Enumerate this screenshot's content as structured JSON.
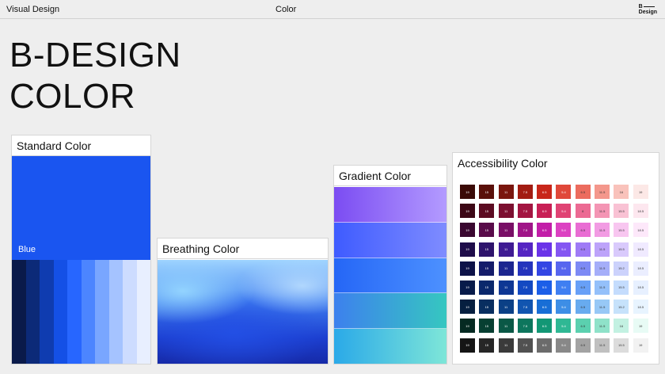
{
  "topbar": {
    "left": "Visual Design",
    "center": "Color",
    "logo_top": "B",
    "logo_bottom": "Design"
  },
  "hero": {
    "line1": "B-DESIGN",
    "line2": "COLOR"
  },
  "standard": {
    "title": "Standard Color",
    "main_label": "Blue",
    "main_color": "#1a55f0",
    "swatches": [
      "#0a1a4a",
      "#0c2a78",
      "#0f3cb0",
      "#1450e6",
      "#2766ff",
      "#4c85ff",
      "#79a6ff",
      "#a5c3ff",
      "#cddcff",
      "#e8efff"
    ]
  },
  "breathing": {
    "title": "Breathing Color"
  },
  "gradient": {
    "title": "Gradient Color",
    "bands": [
      [
        "#7b4cf2",
        "#b39bff"
      ],
      [
        "#3e5bff",
        "#7f8cff"
      ],
      [
        "#2566f6",
        "#4d91ff"
      ],
      [
        "#3d80ee",
        "#36c7c0"
      ],
      [
        "#2aa9e8",
        "#7ee6d8"
      ]
    ]
  },
  "accessibility": {
    "title": "Accessibility Color",
    "labels": [
      "19",
      "15",
      "11",
      "7.5",
      "6.5",
      "5.4",
      "6.5",
      "11.5",
      "16",
      "19"
    ],
    "row_labels": [
      [
        "19",
        "15",
        "11",
        "7.5",
        "6.5",
        "5.4",
        "6.5",
        "11.5",
        "16",
        "19"
      ],
      [
        "19",
        "15",
        "11",
        "7.5",
        "6.9",
        "5.4",
        "8",
        "11.5",
        "15.5",
        "18.5"
      ],
      [
        "19",
        "15",
        "11",
        "7.5",
        "6.5",
        "5.4",
        "6.5",
        "11.5",
        "15.5",
        "18.5"
      ],
      [
        "19",
        "15",
        "11",
        "7.5",
        "6.5",
        "5.4",
        "6.5",
        "11.5",
        "15.5",
        "18.5"
      ],
      [
        "19",
        "15",
        "11",
        "7.5",
        "6.5",
        "5.4",
        "6.5",
        "11.5",
        "15.2",
        "18.5"
      ],
      [
        "19",
        "15",
        "11",
        "7.5",
        "5.5",
        "5.4",
        "6.5",
        "11.5",
        "15.5",
        "18.5"
      ],
      [
        "19",
        "15",
        "11",
        "7.5",
        "6.5",
        "5.4",
        "6.5",
        "11.5",
        "15.2",
        "18.5"
      ],
      [
        "19",
        "15",
        "11",
        "7.5",
        "6.5",
        "5.4",
        "6.5",
        "11.5",
        "16",
        "19"
      ],
      [
        "19",
        "15",
        "11",
        "7.5",
        "6.5",
        "5.4",
        "6.5",
        "11.5",
        "15.5",
        "19"
      ]
    ],
    "rows": [
      [
        "#3b0a07",
        "#5a100a",
        "#7a160e",
        "#a21c12",
        "#c8261a",
        "#e0483a",
        "#ec6c5e",
        "#f4978c",
        "#f9c2bb",
        "#fce8e6"
      ],
      [
        "#3d0716",
        "#5c0b22",
        "#7c0f30",
        "#a31541",
        "#c81f55",
        "#e04374",
        "#ec6a93",
        "#f495b4",
        "#f9c2d4",
        "#fde7ef"
      ],
      [
        "#3a0730",
        "#590b4a",
        "#790f66",
        "#a01588",
        "#c21ea8",
        "#dc42c2",
        "#e96dd3",
        "#f29be3",
        "#f8c6f0",
        "#fde8fa"
      ],
      [
        "#1f0d4a",
        "#2e146c",
        "#3f1b93",
        "#5525c2",
        "#6a33e8",
        "#8456f2",
        "#9f7bf6",
        "#bda3fa",
        "#d9cafc",
        "#f0eaff"
      ],
      [
        "#0d1248",
        "#141c6a",
        "#1c2690",
        "#2534bd",
        "#3346e4",
        "#5766ef",
        "#7d8af5",
        "#a5aef9",
        "#ccd2fc",
        "#ebeeff"
      ],
      [
        "#071b4a",
        "#0a286c",
        "#0e3794",
        "#1349c2",
        "#1b5ee8",
        "#3f7ff2",
        "#68a0f7",
        "#94c0fa",
        "#c4dcfd",
        "#e7f0ff"
      ],
      [
        "#061f40",
        "#082e60",
        "#0b4086",
        "#1155b0",
        "#186ed6",
        "#3d8ee6",
        "#68abef",
        "#97c8f6",
        "#c6e2fb",
        "#e8f4ff"
      ],
      [
        "#052a22",
        "#073f32",
        "#0a5846",
        "#0d765d",
        "#129775",
        "#2fb894",
        "#5bd0af",
        "#8fe2c9",
        "#c3f1e2",
        "#e8fbf5"
      ],
      [
        "#151515",
        "#262626",
        "#3a3a3a",
        "#515151",
        "#6b6b6b",
        "#888888",
        "#a3a3a3",
        "#c0c0c0",
        "#dcdcdc",
        "#f2f2f2"
      ]
    ]
  }
}
